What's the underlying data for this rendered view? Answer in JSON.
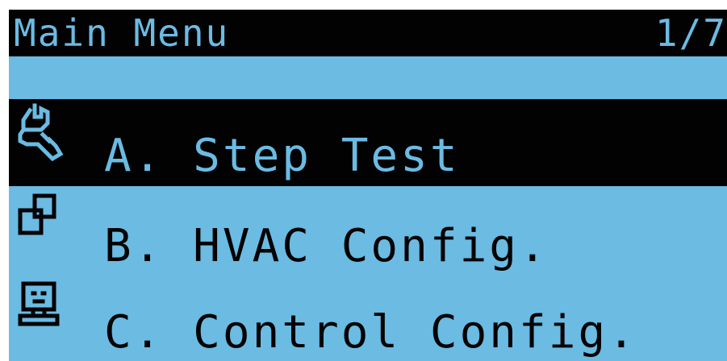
{
  "header": {
    "title": "Main Menu",
    "page": "1/7"
  },
  "menu": {
    "items": [
      {
        "label": "A. Step Test",
        "icon": "wrench-icon",
        "selected": true
      },
      {
        "label": "B. HVAC Config.",
        "icon": "squares-icon",
        "selected": false
      },
      {
        "label": "C. Control Config.",
        "icon": "computer-icon",
        "selected": false
      }
    ]
  },
  "colors": {
    "screen": "#6bbbe3",
    "ink": "#020202"
  }
}
